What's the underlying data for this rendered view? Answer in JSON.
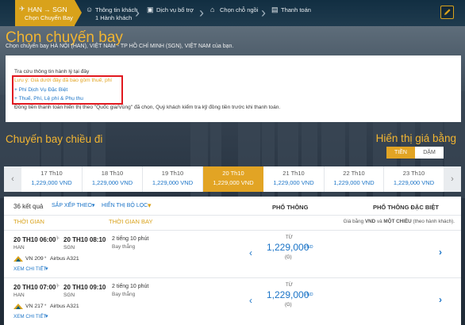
{
  "nav": {
    "steps": [
      {
        "title": "HAN → SGN",
        "sub": "Chọn Chuyến Bay"
      },
      {
        "title": "Thông tin khách",
        "sub": "1 Hành khách"
      },
      {
        "title": "Dịch vụ bổ trợ",
        "sub": ""
      },
      {
        "title": "Chọn chỗ ngồi",
        "sub": ""
      },
      {
        "title": "Thanh toán",
        "sub": ""
      }
    ]
  },
  "header": {
    "title": "Chọn chuyến bay",
    "subtitle": "Chọn chuyến bay HÀ NỘI (HAN), VIỆT NAM - TP HỒ CHÍ MINH (SGN), VIỆT NAM của bạn."
  },
  "info": {
    "line1": "Tra cứu thông tin hành lý tại đây",
    "line2": "Lưu ý: Giá dưới đây đã bao gồm thuế, phí",
    "line3": "+ Phí Dịch Vụ Đặc Biệt",
    "line4": "+ Thuế, Phí, Lệ phí & Phụ thu",
    "line5": "Đồng tiền thanh toán hiển thị theo \"Quốc gia/Vùng\" đã chọn, Quý khách kiểm tra kỹ đồng tiền trước khi thanh toán."
  },
  "section": {
    "title": "Chuyến bay chiều đi",
    "price_display_title": "Hiển thị giá bằng",
    "toggle_money": "TIỀN",
    "toggle_miles": "DẶM"
  },
  "dates": [
    {
      "day": "17 Th10",
      "price": "1,229,000 VND"
    },
    {
      "day": "18 Th10",
      "price": "1,229,000 VND"
    },
    {
      "day": "19 Th10",
      "price": "1,229,000 VND"
    },
    {
      "day": "20 Th10",
      "price": "1,229,000 VND"
    },
    {
      "day": "21 Th10",
      "price": "1,229,000 VND"
    },
    {
      "day": "22 Th10",
      "price": "1,229,000 VND"
    },
    {
      "day": "23 Th10",
      "price": "1,229,000 VND"
    }
  ],
  "list": {
    "results": "36 kết quả",
    "sort_label": "SẮP XẾP THEO:",
    "filter_label": "HIỂN THỊ BỘ LỌC",
    "col_economy": "PHỔ THÔNG",
    "col_special": "PHỔ THÔNG ĐẶC BIỆT",
    "col_departure": "THỜI GIAN",
    "col_duration": "THỜI GIAN BAY",
    "price_note_prefix": "Giá bằng ",
    "price_note_cur": "VND",
    "price_note_mid": " và ",
    "price_note_trip": "MỘT CHIỀU",
    "price_note_suffix": " (theo hành khách)."
  },
  "flights": [
    {
      "dep_time": "20 TH10 06:00",
      "dep_code": "HAN",
      "arr_time": "20 TH10 08:10",
      "arr_code": "SGN",
      "duration": "2 tiếng 10 phút",
      "stops": "Bay thẳng",
      "flight": "VN 209",
      "aircraft": "Airbus A321",
      "details": "XEM CHI TIẾT",
      "from": "TỪ",
      "price": "1,229,000",
      "currency": "VND",
      "fare_class": "(G)"
    },
    {
      "dep_time": "20 TH10 07:00",
      "dep_code": "HAN",
      "arr_time": "20 TH10 09:10",
      "arr_code": "SGN",
      "duration": "2 tiếng 10 phút",
      "stops": "Bay thẳng",
      "flight": "VN 217",
      "aircraft": "Airbus A321",
      "details": "XEM CHI TIẾT",
      "from": "TỪ",
      "price": "1,229,000",
      "currency": "VND",
      "fare_class": "(G)"
    }
  ],
  "colors": {
    "gold": "#d9a21b",
    "blue": "#1b74c7",
    "red": "#e1191f",
    "navy": "#0f2d44"
  }
}
